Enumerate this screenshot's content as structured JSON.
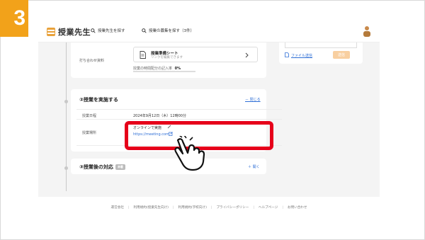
{
  "step": {
    "number": "3"
  },
  "header": {
    "logo_text": "授業先生",
    "nav_search_teacher": "授業先生を探す",
    "nav_search_recruit": "授業の募集を探す（3件）"
  },
  "side_panel": {
    "file_link": "ファイル送信",
    "send_button": "送信"
  },
  "materials": {
    "row_label": "打ち合わせ資料",
    "sheet_title": "授業準備シート",
    "sheet_subtitle": "リンクを編集できます",
    "progress_label": "授業の時間配分の記入率",
    "progress_value": "0%",
    "progress_fraction": 0
  },
  "section2": {
    "title": "②授業を実施する",
    "toggle": "－ 閉じる",
    "date_label": "授業日程",
    "date_value": "2024年9月12日（木）12時00分",
    "place_label": "授業場所",
    "place_value": "オンラインで実施",
    "place_url": "https://meeting.com"
  },
  "section3": {
    "title": "③授業後の対応",
    "badge": "未着",
    "toggle": "＋ 開く"
  },
  "footer": {
    "links": [
      "運営会社",
      "利用規約(授業先生向け)",
      "利用規約(学校向け)",
      "プライバシーポリシー",
      "ヘルプページ",
      "お問い合わせ"
    ]
  },
  "colors": {
    "accent": "#f2a21a",
    "highlight": "#e6001a",
    "link": "#2f6fd6"
  },
  "icons": [
    "search-icon",
    "document-icon",
    "chevron-right-icon",
    "pencil-icon",
    "external-link-icon",
    "file-icon",
    "avatar-icon",
    "pointing-hand-icon"
  ]
}
